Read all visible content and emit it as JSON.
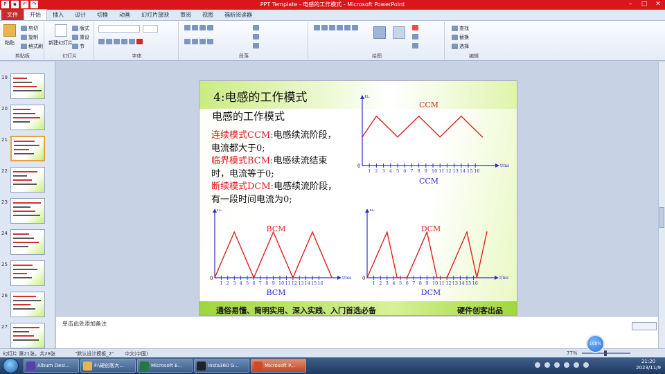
{
  "window": {
    "title": "PPT Template - 电感的工作模式 - Microsoft PowerPoint",
    "controls": [
      "–",
      "□",
      "✕"
    ]
  },
  "ribbon": {
    "tabs": [
      "文件",
      "开始",
      "插入",
      "设计",
      "切换",
      "动画",
      "幻灯片放映",
      "审阅",
      "视图",
      "福昕阅读器"
    ],
    "active_tab": "开始",
    "groups": {
      "clipboard": {
        "name": "剪贴板",
        "paste": "粘贴",
        "cut": "剪切",
        "copy": "复制",
        "format_painter": "格式刷"
      },
      "slides": {
        "name": "幻灯片",
        "new_slide": "新建幻灯片",
        "layout": "版式",
        "reset": "重设",
        "section": "节"
      },
      "font": {
        "name": "字体"
      },
      "paragraph": {
        "name": "段落"
      },
      "drawing": {
        "name": "绘图"
      },
      "editing": {
        "name": "编辑",
        "find": "查找",
        "replace": "替换",
        "select": "选择"
      }
    }
  },
  "slide_panel": {
    "numbers": [
      "19",
      "20",
      "21",
      "22",
      "23",
      "24",
      "25",
      "26",
      "27"
    ],
    "active_index": 2
  },
  "slide": {
    "title": "4:电感的工作模式",
    "subtitle": "电感的工作模式",
    "ccm_label": "连续模式CCM:",
    "ccm_text": "电感续流阶段，电流都大于0;",
    "bcm_label": "临界模式BCM:",
    "bcm_text": "电感续流结束时，电流等于0;",
    "dcm_label": "断续模式DCM:",
    "dcm_text": "电感续流阶段，有一段时间电流为0;",
    "footer_left": "通俗易懂、简明实用、深入实践、入门首选必备",
    "footer_right": "硬件创客出品"
  },
  "chart_data": [
    {
      "type": "line",
      "title": "CCM",
      "caption": "CCM",
      "ylabel": "IL",
      "xlabel": "t/ms",
      "origin_label": "0",
      "ticks": [
        "1",
        "2",
        "3",
        "4",
        "5",
        "6",
        "7",
        "8",
        "9",
        "10",
        "11",
        "12",
        "13",
        "14",
        "15",
        "16"
      ],
      "x": [
        0,
        2,
        5,
        8,
        11,
        14,
        17
      ],
      "y": [
        0.55,
        0.95,
        0.55,
        0.95,
        0.55,
        0.95,
        0.55
      ],
      "ylim": [
        0,
        1.2
      ]
    },
    {
      "type": "line",
      "title": "BCM",
      "caption": "BCM",
      "ylabel": "IL",
      "xlabel": "t/ms",
      "origin_label": "0",
      "ticks": [
        "1",
        "2",
        "3",
        "4",
        "5",
        "6",
        "7",
        "8",
        "9",
        "10",
        "11",
        "12",
        "13",
        "14",
        "15",
        "16"
      ],
      "x": [
        0,
        3,
        6,
        9,
        12,
        15,
        18
      ],
      "y": [
        0,
        0.9,
        0,
        0.9,
        0,
        0.9,
        0
      ],
      "ylim": [
        0,
        1.2
      ]
    },
    {
      "type": "line",
      "title": "DCM",
      "caption": "DCM",
      "ylabel": "IL",
      "xlabel": "t/ms",
      "origin_label": "0",
      "ticks": [
        "1",
        "2",
        "3",
        "4",
        "5",
        "6",
        "7",
        "8",
        "9",
        "10",
        "11",
        "12",
        "13",
        "14",
        "15",
        "16"
      ],
      "x": [
        0,
        3,
        4.5,
        6,
        9,
        10.5,
        12,
        15,
        16.5,
        18
      ],
      "y": [
        0,
        0.9,
        0,
        0,
        0.9,
        0,
        0,
        0.9,
        0,
        0.9
      ],
      "ylim": [
        0,
        1.2
      ]
    }
  ],
  "notes": {
    "placeholder": "单击此处添加备注"
  },
  "status": {
    "slide_info": "幻灯片 第21张，共28张",
    "theme": "\"默认设计模板_2\"",
    "language": "中文(中国)",
    "zoom": "77%"
  },
  "taskbar": {
    "items": [
      {
        "label": "Album Desi...",
        "color": "#5a3fa8"
      },
      {
        "label": "F:\\硬创客大...",
        "color": "#e8b64a"
      },
      {
        "label": "Microsoft E...",
        "color": "#1f7a3c"
      },
      {
        "label": "Insta360 G...",
        "color": "#222222"
      },
      {
        "label": "Microsoft P...",
        "color": "#d24726"
      }
    ],
    "time": "21:20",
    "date": "2023/11/9"
  },
  "float_button": "100%"
}
